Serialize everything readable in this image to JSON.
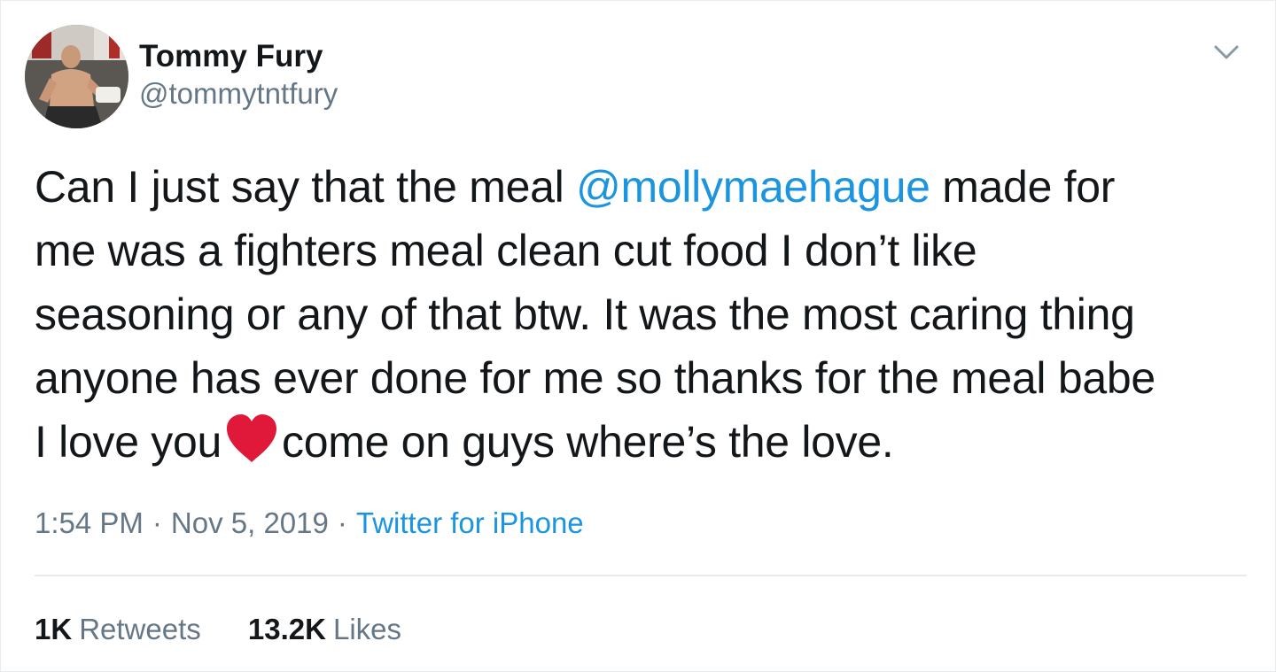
{
  "user": {
    "display_name": "Tommy Fury",
    "handle": "@tommytntfury"
  },
  "tweet": {
    "line1_pre": "Can I just say that the meal ",
    "mention": "@mollymaehague",
    "line1_post": " made for",
    "line2": "me was a fighters meal clean cut food I don’t like",
    "line3": "seasoning or any of that btw. It was the most caring thing",
    "line4": "anyone has ever done for me so thanks for the meal babe",
    "line5_pre": "I love you",
    "line5_post": "come on guys where’s the love."
  },
  "meta": {
    "time": "1:54 PM",
    "separator": "·",
    "date": "Nov 5, 2019",
    "source": "Twitter for iPhone"
  },
  "stats": {
    "retweets_count": "1K",
    "retweets_label": "Retweets",
    "likes_count": "13.2K",
    "likes_label": "Likes"
  },
  "icons": {
    "menu": "chevron-down-icon",
    "emoji": "red-heart-emoji"
  },
  "colors": {
    "text": "#14171a",
    "secondary": "#657786",
    "link": "#1b95e0",
    "heart": "#e0193a",
    "divider": "#e6ecf0"
  }
}
